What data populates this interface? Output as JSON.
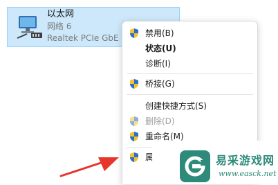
{
  "adapter": {
    "name": "以太网",
    "network": "网络 6",
    "device": "Realtek PCIe GbE F"
  },
  "menu": {
    "items": [
      {
        "label": "禁用(B)",
        "icon": "uac-shield-icon"
      },
      {
        "label": "状态(U)",
        "bold": true
      },
      {
        "label": "诊断(I)"
      },
      {
        "label": "桥接(G)",
        "icon": "uac-shield-icon"
      },
      {
        "label": "创建快捷方式(S)"
      },
      {
        "label": "删除(D)",
        "icon": "uac-shield-icon",
        "disabled": true
      },
      {
        "label": "重命名(M)",
        "icon": "uac-shield-icon"
      },
      {
        "label": "属",
        "icon": "uac-shield-icon"
      }
    ]
  },
  "annotation": {
    "arrow_color": "#e8352b"
  },
  "watermark": {
    "title": "易采游戏网",
    "url": "www.easck.net",
    "color": "#2e8b7a"
  }
}
